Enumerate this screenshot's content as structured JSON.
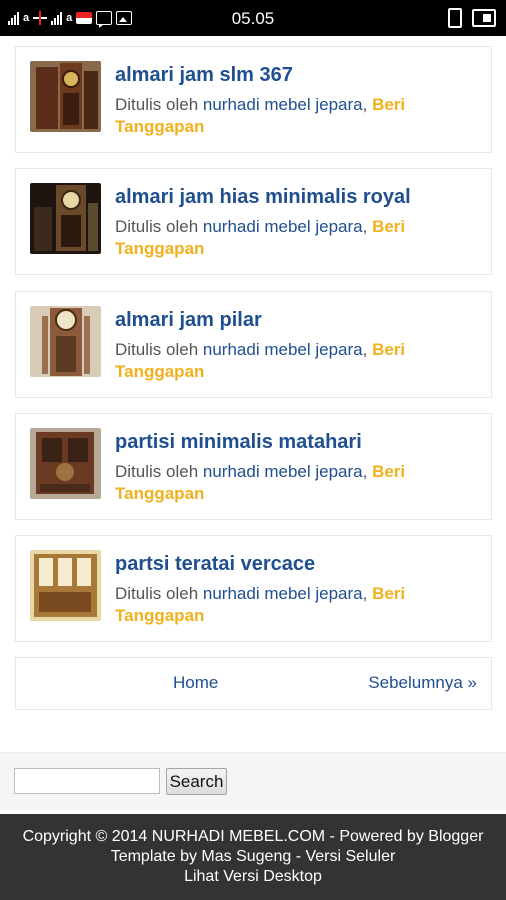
{
  "statusbar": {
    "time": "05.05",
    "carrier1": "a",
    "carrier2": "a",
    "icons": [
      "signal-icon",
      "signal-icon",
      "telkomsel-icon",
      "chat-icon",
      "image-icon",
      "vibrate-icon",
      "battery-icon"
    ]
  },
  "posts": [
    {
      "title": "almari jam slm 367",
      "by": "Ditulis oleh",
      "author": "nurhadi mebel jepara",
      "sep": ",",
      "reply": "Beri Tanggapan"
    },
    {
      "title": "almari jam hias minimalis royal",
      "by": "Ditulis oleh",
      "author": "nurhadi mebel jepara",
      "sep": ",",
      "reply": "Beri Tanggapan"
    },
    {
      "title": "almari jam pilar",
      "by": "Ditulis oleh",
      "author": "nurhadi mebel jepara",
      "sep": ",",
      "reply": "Beri Tanggapan"
    },
    {
      "title": "partisi minimalis matahari",
      "by": "Ditulis oleh",
      "author": "nurhadi mebel jepara",
      "sep": ",",
      "reply": "Beri Tanggapan"
    },
    {
      "title": "partsi teratai vercace",
      "by": "Ditulis oleh",
      "author": "nurhadi mebel jepara",
      "sep": ",",
      "reply": "Beri Tanggapan"
    }
  ],
  "pager": {
    "home": "Home",
    "prev": "Sebelumnya »"
  },
  "search": {
    "value": "",
    "button": "Search"
  },
  "footer": {
    "line1": "Copyright © 2014 NURHADI MEBEL.COM - Powered by Blogger",
    "line2": "Template by Mas Sugeng - Versi Seluler",
    "line3": "Lihat Versi Desktop"
  },
  "colors": {
    "link": "#1f4f8f",
    "accent": "#f2b01e",
    "footer_bg": "#333333"
  }
}
